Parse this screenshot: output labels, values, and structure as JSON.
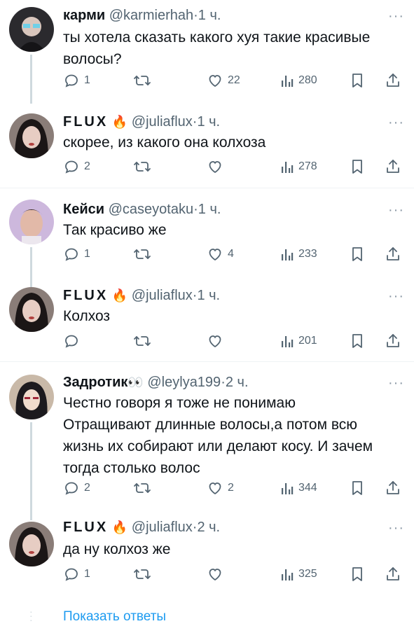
{
  "tweets": [
    {
      "name": "карми",
      "handle": "@karmierhah",
      "dot": "·",
      "time": "1 ч.",
      "text_lines": [
        "ты хотела сказать какого хуя такие красивые",
        "волосы?"
      ],
      "replies": "1",
      "retweets": "",
      "likes": "22",
      "views": "280"
    },
    {
      "name": "FLUX",
      "emoji": "🔥",
      "handle": "@juliaflux",
      "dot": "·",
      "time": "1 ч.",
      "text_lines": [
        "скорее, из какого она колхоза"
      ],
      "replies": "2",
      "retweets": "",
      "likes": "",
      "views": "278"
    },
    {
      "name": "Кейси",
      "handle": "@caseyotaku",
      "dot": "·",
      "time": "1 ч.",
      "text_lines": [
        "Так красиво же"
      ],
      "replies": "1",
      "retweets": "",
      "likes": "4",
      "views": "233"
    },
    {
      "name": "FLUX",
      "emoji": "🔥",
      "handle": "@juliaflux",
      "dot": "·",
      "time": "1 ч.",
      "text_lines": [
        "Колхоз"
      ],
      "replies": "",
      "retweets": "",
      "likes": "",
      "views": "201"
    },
    {
      "name": "Задротик",
      "emoji": "👀",
      "handle": "@leylya199",
      "dot": "·",
      "time": "2 ч.",
      "text_lines": [
        "Честно говоря я тоже не понимаю",
        "Отращивают длинные волосы,а потом всю",
        "жизнь их собирают или делают косу. И зачем",
        "тогда столько волос"
      ],
      "replies": "2",
      "retweets": "",
      "likes": "2",
      "views": "344"
    },
    {
      "name": "FLUX",
      "emoji": "🔥",
      "handle": "@juliaflux",
      "dot": "·",
      "time": "2 ч.",
      "text_lines": [
        "да ну колхоз же"
      ],
      "replies": "1",
      "retweets": "",
      "likes": "",
      "views": "325"
    }
  ],
  "show_replies": "Показать ответы",
  "more_glyph": "···",
  "colors": {
    "accent": "#1d9bf0",
    "text": "#0f1419",
    "secondary": "#536471",
    "line": "#cfd9de"
  },
  "icons": [
    "reply-icon",
    "retweet-icon",
    "like-icon",
    "views-icon",
    "bookmark-icon",
    "share-icon",
    "more-icon"
  ]
}
